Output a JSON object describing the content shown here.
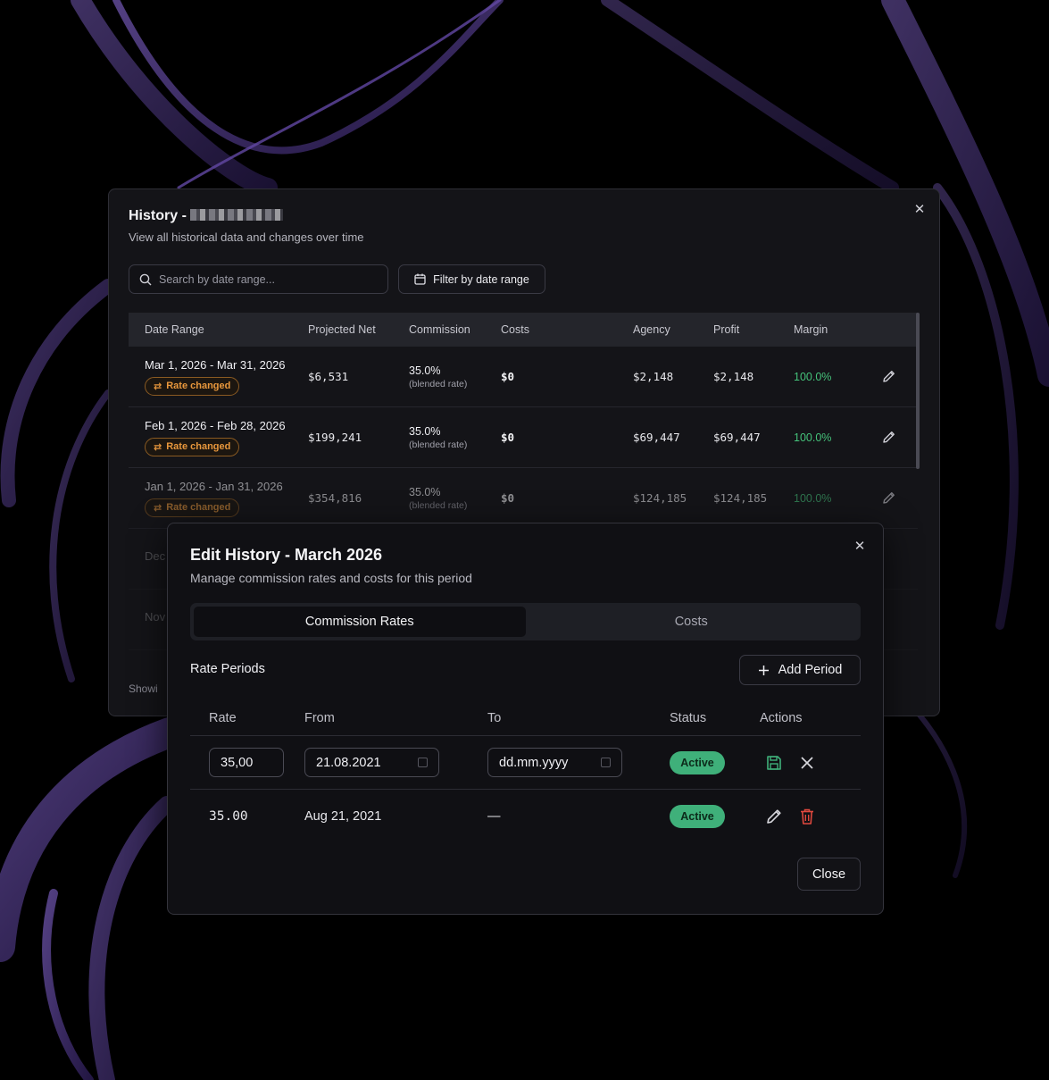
{
  "history": {
    "title": "History -",
    "subtitle": "View all historical data and changes over time",
    "search_placeholder": "Search by date range...",
    "filter_label": "Filter by date range",
    "showing_text": "Showi",
    "columns": [
      "Date Range",
      "Projected Net",
      "Commission",
      "Costs",
      "Agency",
      "Profit",
      "Margin"
    ],
    "rows": [
      {
        "date": "Mar 1, 2026 - Mar 31, 2026",
        "badge": "Rate changed",
        "net": "$6,531",
        "commission": "35.0%",
        "commission_sub": "(blended rate)",
        "costs": "$0",
        "agency": "$2,148",
        "profit": "$2,148",
        "margin": "100.0%"
      },
      {
        "date": "Feb 1, 2026 - Feb 28, 2026",
        "badge": "Rate changed",
        "net": "$199,241",
        "commission": "35.0%",
        "commission_sub": "(blended rate)",
        "costs": "$0",
        "agency": "$69,447",
        "profit": "$69,447",
        "margin": "100.0%"
      },
      {
        "date": "Jan 1, 2026 - Jan 31, 2026",
        "badge": "Rate changed",
        "net": "$354,816",
        "commission": "35.0%",
        "commission_sub": "(blended rate)",
        "costs": "$0",
        "agency": "$124,185",
        "profit": "$124,185",
        "margin": "100.0%"
      },
      {
        "date": "Dec"
      },
      {
        "date": "Nov"
      }
    ]
  },
  "edit": {
    "title": "Edit History - March 2026",
    "subtitle": "Manage commission rates and costs for this period",
    "tabs": [
      "Commission Rates",
      "Costs"
    ],
    "active_tab": "Commission Rates",
    "section_title": "Rate Periods",
    "add_label": "Add Period",
    "columns": [
      "Rate",
      "From",
      "To",
      "Status",
      "Actions"
    ],
    "edit_row": {
      "rate": "35,00",
      "from": "21.08.2021",
      "to": "dd.mm.yyyy",
      "status": "Active"
    },
    "row": {
      "rate": "35.00",
      "from": "Aug 21, 2021",
      "to": "—",
      "status": "Active"
    },
    "close_label": "Close"
  },
  "colors": {
    "accent_green": "#3fb07a",
    "badge_orange": "#e8973c",
    "delete_red": "#e0483e"
  }
}
